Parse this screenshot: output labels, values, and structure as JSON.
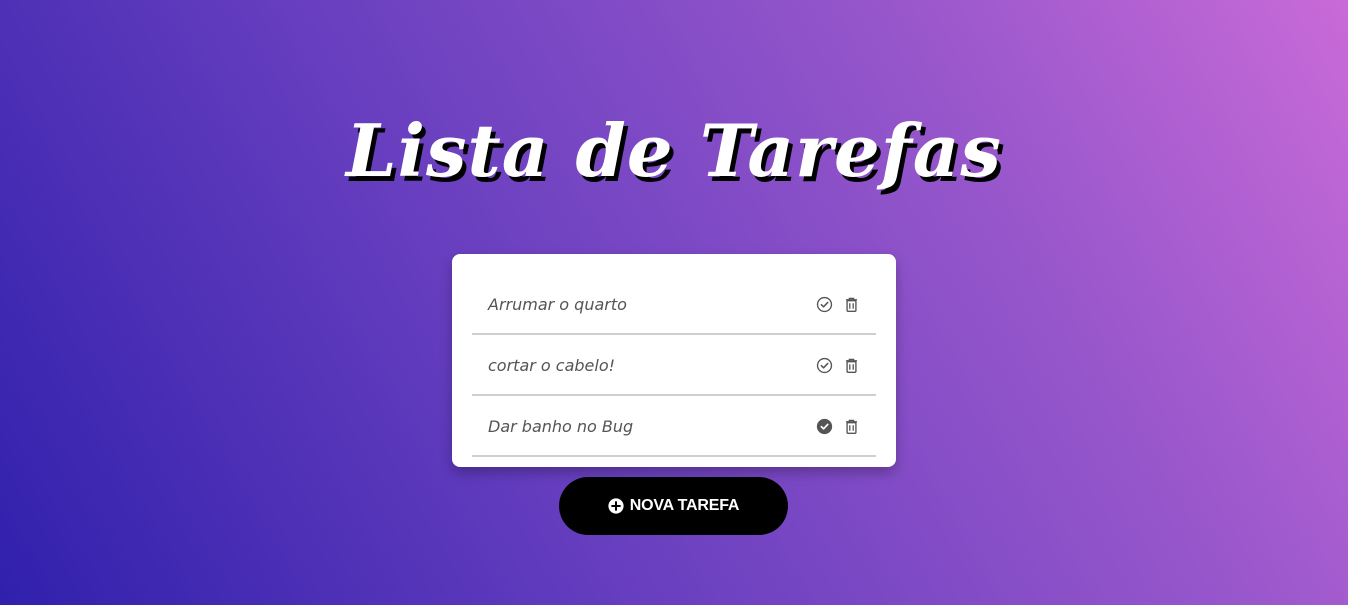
{
  "header": {
    "title": "Lista de Tarefas"
  },
  "tasks": [
    {
      "text": "Arrumar o quarto",
      "done": false
    },
    {
      "text": "cortar o cabelo!",
      "done": false
    },
    {
      "text": "Dar banho no Bug",
      "done": true
    }
  ],
  "new_task_button": {
    "label": "NOVA TAREFA",
    "icon": "plus-circle-icon"
  },
  "icons": {
    "complete": "check-circle-icon",
    "delete": "trash-icon"
  },
  "colors": {
    "gradient_start": "#3020ac",
    "gradient_end": "#c96ad8",
    "card": "#ffffff",
    "button": "#000000",
    "icon": "#555555"
  }
}
